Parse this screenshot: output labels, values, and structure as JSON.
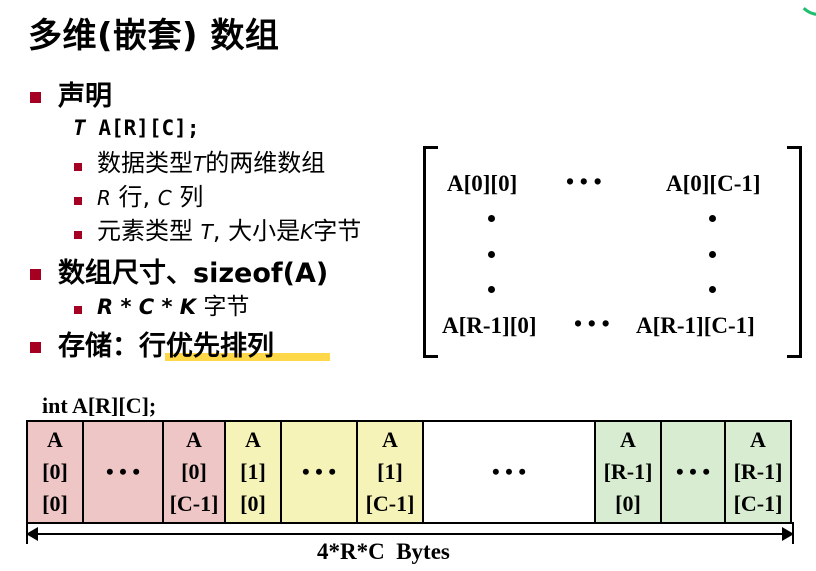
{
  "title": "多维(嵌套) 数组",
  "bullets": {
    "declare": "声明",
    "decl_T": "T",
    "decl_rest": "A[R][C];",
    "sub1_pre": "数据类型",
    "sub1_T": "T",
    "sub1_post": "的两维数组",
    "sub2_R": "R",
    "sub2_mid": " 行, ",
    "sub2_C": "C",
    "sub2_post": " 列",
    "sub3_pre": "元素类型 ",
    "sub3_T": "T",
    "sub3_mid": ", 大小是",
    "sub3_K": "K",
    "sub3_post": "字节",
    "size_title": "数组尺寸、sizeof(A)",
    "size_expr": "R * C * K",
    "size_unit": " 字节",
    "storage_pre": "存储：",
    "storage_key": "行优先排列"
  },
  "matrix": {
    "top_left": "A[0][0]",
    "top_dots": "• • •",
    "top_right": "A[0][C-1]",
    "bottom_left": "A[R-1][0]",
    "bottom_dots": "• • •",
    "bottom_right": "A[R-1][C-1]"
  },
  "memory": {
    "decl": "int A[R][C];",
    "cells": [
      {
        "l1": "A",
        "l2": "[0]",
        "l3": "[0]"
      },
      {
        "l1": "",
        "l2": "• • •",
        "l3": ""
      },
      {
        "l1": "A",
        "l2": "[0]",
        "l3": "[C-1]"
      },
      {
        "l1": "A",
        "l2": "[1]",
        "l3": "[0]"
      },
      {
        "l1": "",
        "l2": "• • •",
        "l3": ""
      },
      {
        "l1": "A",
        "l2": "[1]",
        "l3": "[C-1]"
      },
      {
        "l1": "",
        "l2": "• • •",
        "l3": ""
      },
      {
        "l1": "A",
        "l2": "[R-1]",
        "l3": "[0]"
      },
      {
        "l1": "",
        "l2": "• • •",
        "l3": ""
      },
      {
        "l1": "A",
        "l2": "[R-1]",
        "l3": "[C-1]"
      }
    ],
    "total_label": "4*R*C  Bytes"
  },
  "colors": {
    "bullet": "#a50021",
    "highlight": "#ffd84a",
    "row0": "#efc6c6",
    "row1": "#f6f3b9",
    "rowR": "#d7ecd0",
    "accent_arc": "#1fbf70"
  }
}
